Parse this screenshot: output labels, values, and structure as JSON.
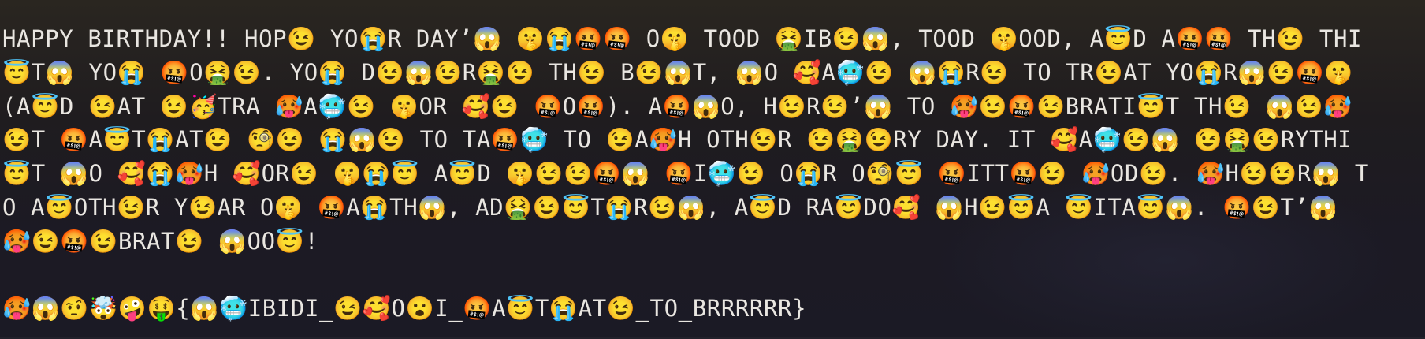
{
  "terminal": {
    "output_lines": [
      "HAPPY BIRTHDAY!! HOP😉 YO😭R DAY’😱 🤫😭🤬🤬 O🤫 TOOD 🤮IB😉😱, TOOD 🤫OOD, A😇D A🤬🤬 TH😉 THI",
      "😇T😱 YO😭 🤬O🤮😉. YO😭 D😉😱😉R🤮😉 TH😉 B😉😱T, 😱O 🥰A🥶😉 😱😭R😉 TO TR😉AT YO😭R😱😉🤬🤫",
      "(A😇D 😉AT 😉🥳TRA 🥵A🥶😉 🤫OR 🥰😉 🤬O🤬). A🤬😱O, H😉R😉’😱 TO 🥵😉🤬😉BRATI😇T TH😉 😱😉🥵",
      "😉T 🤬A😇T😭AT😉 🧐😉 😭😱😉 TO TA🤬🥶 TO 😉A🥵H OTH😉R 😉🤮😉RY DAY. IT 🥰A🥶😉😱 😉🤮😉RYTHI",
      "😇T 😱O 🥰😭🥵H 🥰OR😉 🤫😭😇 A😇D 🤫😉😉🤬😱 🤬I🥶😉 O😭R O🧐😇 🤬ITT🤬😉 🥵OD😉. 🥵H😉😉R😱 T",
      "O A😇OTH😉R Y😉AR O🤫 🤬A😭TH😱, AD🤮😉😇T😭R😉😱, A😇D RA😇DO🥰 😱H😉😇A 😇ITA😇😱. 🤬😉T’😱",
      "🥵😉🤬😉BRAT😉 😱OO😇!",
      "",
      "🥵😱🤨🤯🤪🤑{😱🥶IBIDI_😉🥰O😮I_🤬A😇T😭AT😉_TO_BRRRRRR}"
    ]
  }
}
